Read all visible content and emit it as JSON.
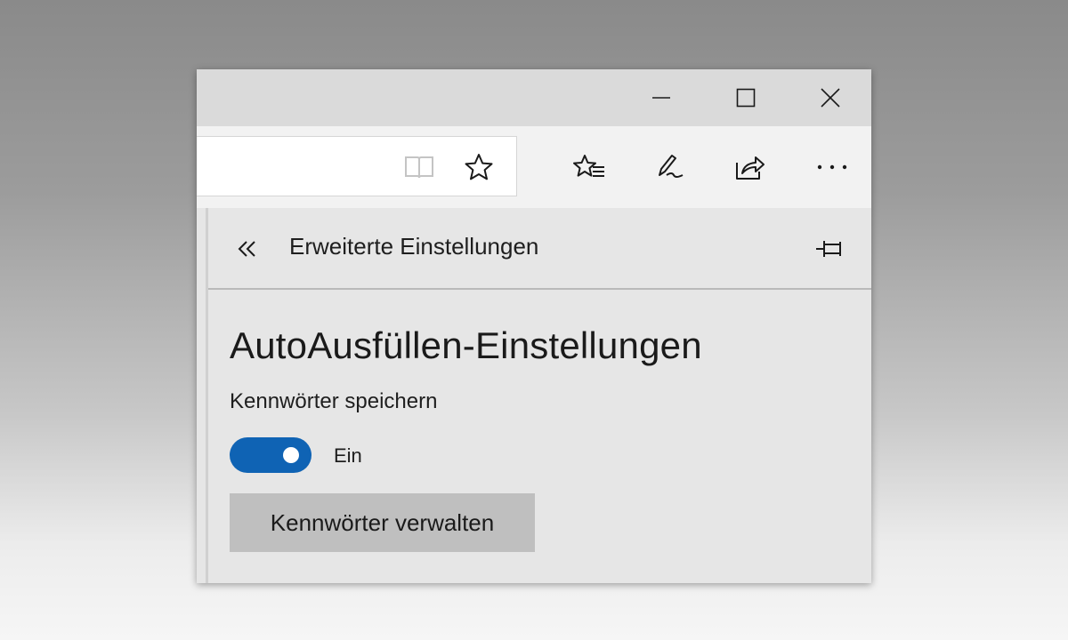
{
  "window_controls": {
    "minimize_icon": "minimize-icon",
    "maximize_icon": "maximize-icon",
    "close_icon": "close-icon"
  },
  "toolbar": {
    "address_value": "",
    "icons": [
      "reading-view-icon",
      "favorite-star-icon",
      "favorites-hub-icon",
      "web-note-pen-icon",
      "share-icon",
      "more-ellipsis-icon"
    ],
    "more_label": "···"
  },
  "panel": {
    "back_icon": "double-chevron-left-icon",
    "back_glyph": "«",
    "title": "Erweiterte Einstellungen",
    "pin_icon": "pin-icon",
    "section_heading": "AutoAusfüllen-Einstellungen",
    "save_passwords_label": "Kennwörter speichern",
    "toggle_state": "Ein",
    "toggle_on": true,
    "manage_button_label": "Kennwörter verwalten"
  },
  "colors": {
    "accent": "#0f63b4",
    "panel_bg": "#e6e6e6",
    "titlebar_bg": "#dadada",
    "toolbar_bg": "#f2f2f2",
    "button_bg": "#bfbfbf"
  }
}
